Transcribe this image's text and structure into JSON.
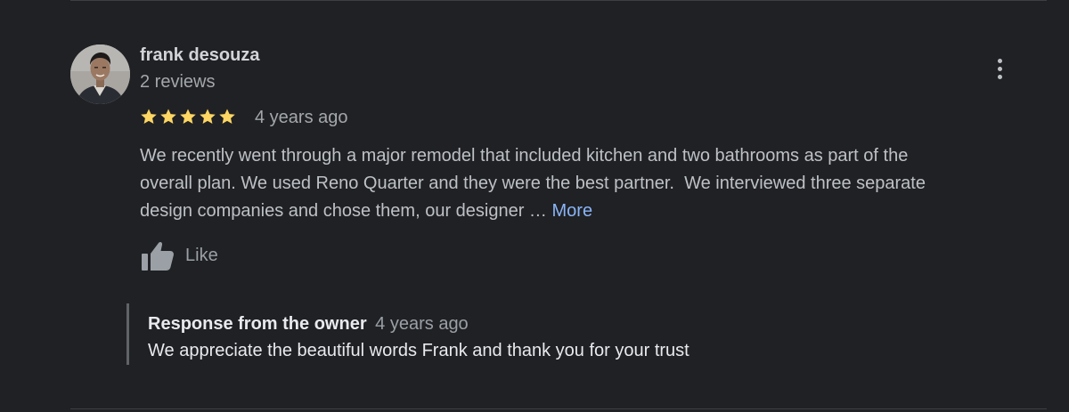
{
  "review": {
    "reviewer_name": "frank desouza",
    "review_count": "2 reviews",
    "rating": 5,
    "max_rating": 5,
    "time": "4 years ago",
    "text_lines": [
      "We recently went through a major remodel that included kitchen and two bathrooms as part of the",
      "overall plan. We used Reno Quarter and they were the best partner.  We interviewed three separate",
      "design companies and chose them, our designer … "
    ],
    "more_label": "More",
    "like_label": "Like"
  },
  "owner_response": {
    "title": "Response from the owner",
    "time": "4 years ago",
    "text": "We appreciate the beautiful words Frank and thank you for your trust"
  },
  "colors": {
    "background": "#202124",
    "star": "#fdd663",
    "link": "#8ab4f8"
  },
  "icons": {
    "menu": "more-vert-icon",
    "like": "thumb-up-icon",
    "star": "star-icon"
  }
}
